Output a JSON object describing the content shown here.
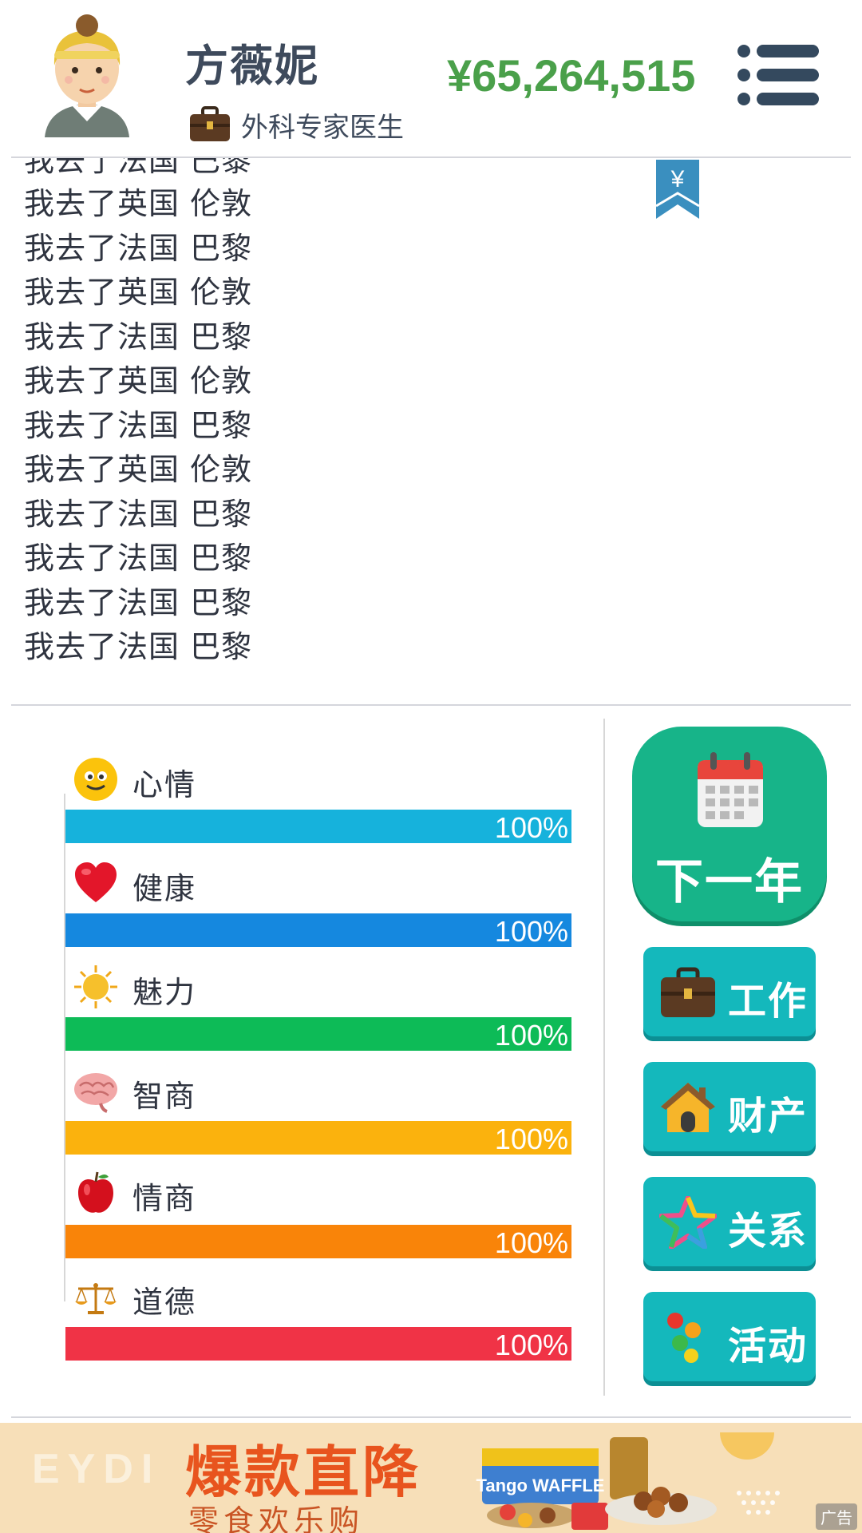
{
  "header": {
    "name": "方薇妮",
    "job": "外科专家医生",
    "money": "¥65,264,515"
  },
  "log": {
    "partial_line": "我去了法国 巴黎",
    "lines": [
      "我去了英国 伦敦",
      "我去了法国 巴黎",
      "我去了英国 伦敦",
      "我去了法国 巴黎",
      "我去了英国 伦敦",
      "我去了法国 巴黎",
      "我去了英国 伦敦",
      "我去了法国 巴黎",
      "我去了法国 巴黎",
      "我去了法国 巴黎",
      "我去了法国 巴黎"
    ],
    "bookmark_symbol": "¥"
  },
  "stats": [
    {
      "label": "心情",
      "value": "100%",
      "fill": 1.0,
      "color": "#16b2dc",
      "icon": "smiley-icon"
    },
    {
      "label": "健康",
      "value": "100%",
      "fill": 1.0,
      "color": "#1588df",
      "icon": "heart-icon"
    },
    {
      "label": "魅力",
      "value": "100%",
      "fill": 1.0,
      "color": "#0dbb57",
      "icon": "sun-icon"
    },
    {
      "label": "智商",
      "value": "100%",
      "fill": 1.0,
      "color": "#fbb20d",
      "icon": "brain-icon"
    },
    {
      "label": "情商",
      "value": "100%",
      "fill": 1.0,
      "color": "#f98409",
      "icon": "apple-icon"
    },
    {
      "label": "道德",
      "value": "100%",
      "fill": 1.0,
      "color": "#f03346",
      "icon": "scales-icon"
    }
  ],
  "actions": {
    "next_year": "下一年",
    "work": "工作",
    "property": "财产",
    "relations": "关系",
    "activities": "活动"
  },
  "ad": {
    "ghost_text": "EYDI",
    "headline": "爆款直降",
    "sub": "零食欢乐购",
    "product": "Tango WAFFLE",
    "tag": "广告"
  },
  "colors": {
    "money": "#4aa04a",
    "next_year_bg": "#17b489",
    "action_bg": "#14b8bc",
    "text": "#3e4a5c"
  }
}
